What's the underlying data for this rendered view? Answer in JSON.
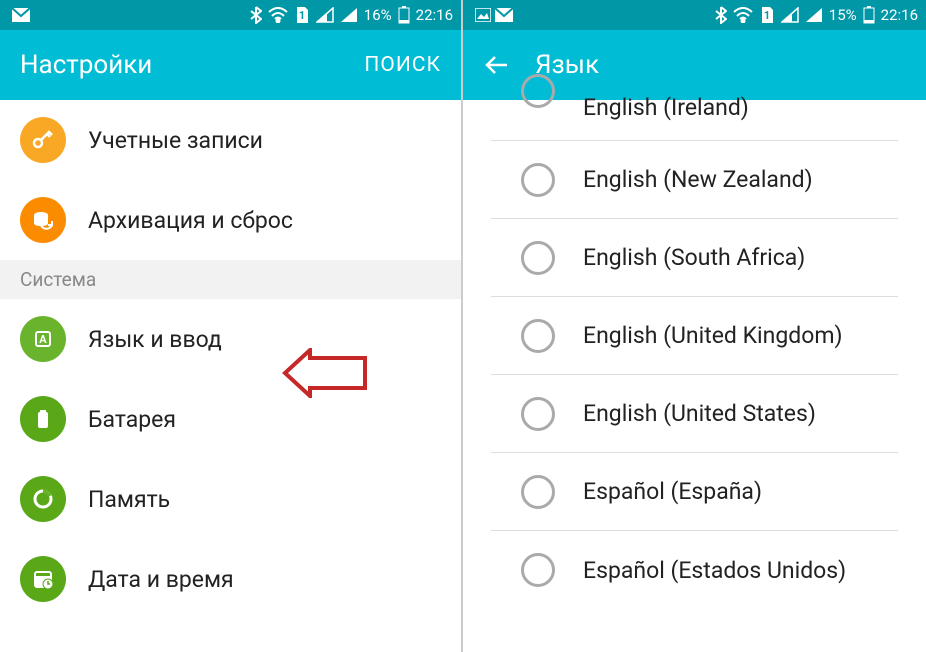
{
  "left": {
    "status": {
      "battery_pct": "16%",
      "time": "22:16",
      "sim": "1"
    },
    "title": "Настройки",
    "search_label": "ПОИСК",
    "items": {
      "accounts": "Учетные записи",
      "backup": "Архивация и сброс",
      "section_system": "Система",
      "lang_input": "Язык и ввод",
      "battery": "Батарея",
      "memory": "Память",
      "datetime": "Дата и время"
    }
  },
  "right": {
    "status": {
      "battery_pct": "15%",
      "time": "22:16",
      "sim": "1"
    },
    "title": "Язык",
    "langs": {
      "l0": "English (Ireland)",
      "l1": "English (New Zealand)",
      "l2": "English (South Africa)",
      "l3": "English (United Kingdom)",
      "l4": "English (United States)",
      "l5": "Español (España)",
      "l6": "Español (Estados Unidos)"
    }
  }
}
